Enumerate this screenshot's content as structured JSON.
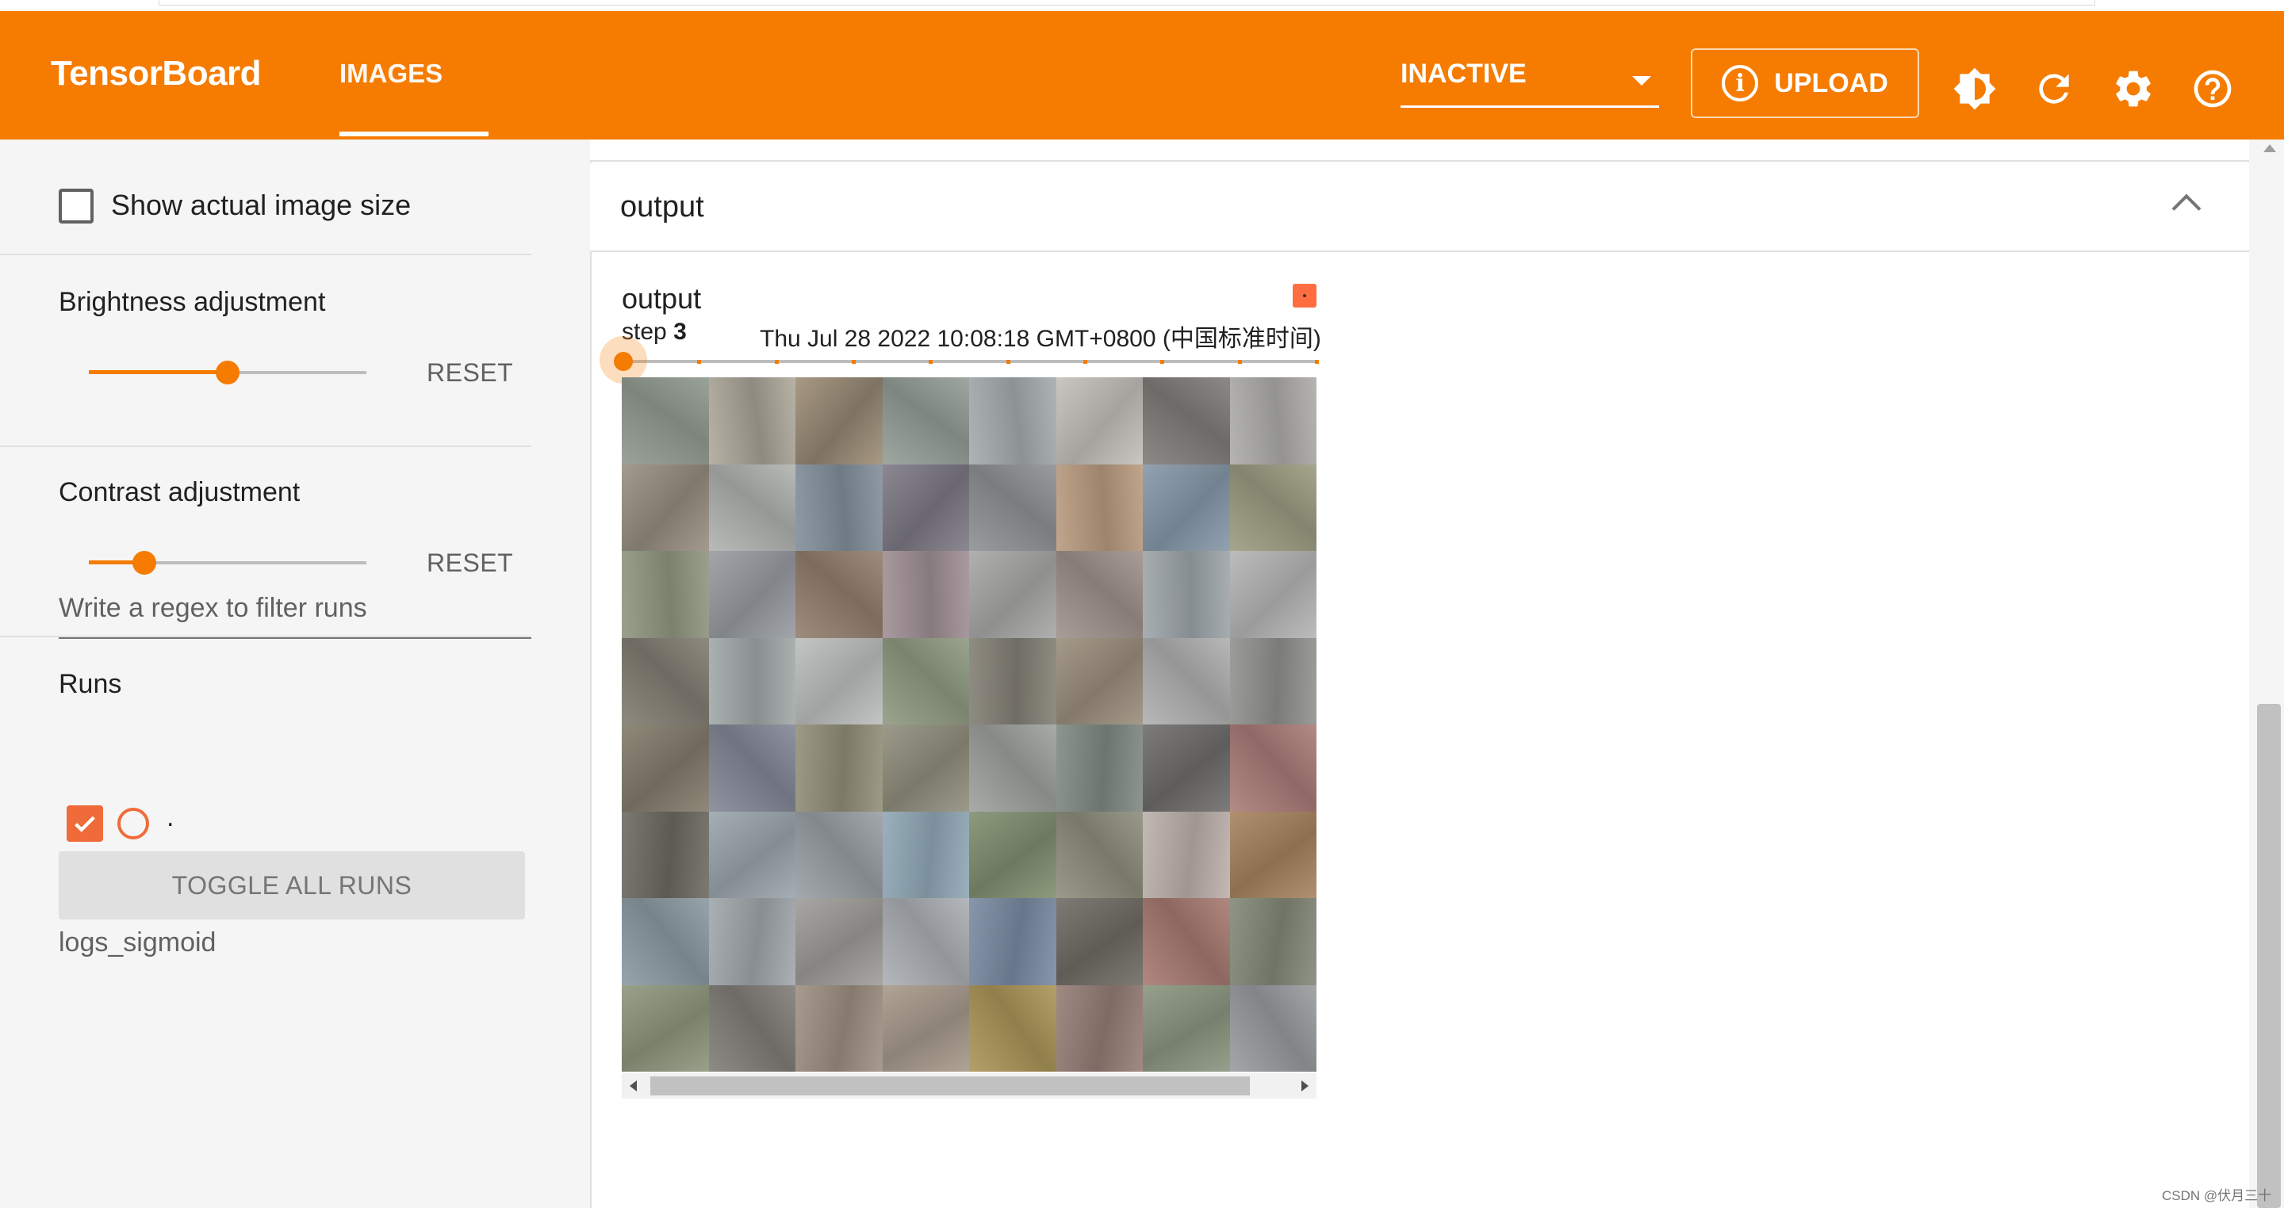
{
  "header": {
    "brand": "TensorBoard",
    "active_tab": "IMAGES",
    "status_select": "INACTIVE",
    "upload_label": "UPLOAD",
    "colors": {
      "primary": "#f57c00",
      "text": "#ffffff"
    },
    "icons": [
      "info-icon",
      "theme-toggle-icon",
      "refresh-icon",
      "settings-icon",
      "help-icon"
    ]
  },
  "sidebar": {
    "show_actual_size_label": "Show actual image size",
    "show_actual_size_checked": false,
    "brightness": {
      "label": "Brightness adjustment",
      "reset_label": "RESET",
      "value_fraction": 0.5
    },
    "contrast": {
      "label": "Contrast adjustment",
      "reset_label": "RESET",
      "value_fraction": 0.2
    },
    "runs": {
      "heading": "Runs",
      "filter_placeholder": "Write a regex to filter runs",
      "run_label": ".",
      "run_checked": true,
      "toggle_all_label": "TOGGLE ALL RUNS",
      "run_name": "logs_sigmoid",
      "run_color": "#ef6c3a"
    }
  },
  "main": {
    "card_title": "output",
    "image_card": {
      "title": "output",
      "step_prefix": "step",
      "step_value": "3",
      "timestamp": "Thu Jul 28 2022 10:08:18 GMT+0800 (中国标准时间)",
      "step_index": 0,
      "step_count": 10,
      "grid_rows": 8,
      "grid_cols": 8
    }
  },
  "watermark": "CSDN @伏月三十"
}
